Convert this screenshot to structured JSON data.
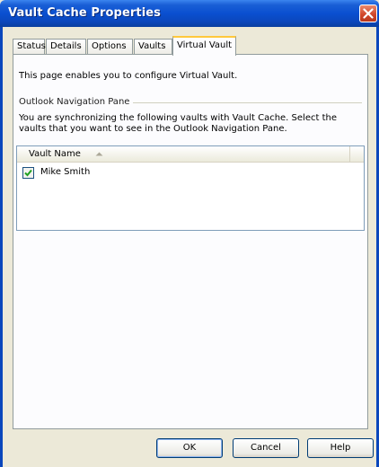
{
  "window": {
    "title": "Vault Cache Properties",
    "close_icon": "close-icon",
    "title_bar_color": "#0a4fd0"
  },
  "tabs": [
    {
      "label": "Status",
      "active": false
    },
    {
      "label": "Details",
      "active": false
    },
    {
      "label": "Options",
      "active": false
    },
    {
      "label": "Vaults",
      "active": false
    },
    {
      "label": "Virtual Vault",
      "active": true
    }
  ],
  "page": {
    "description": "This page enables you to configure Virtual Vault.",
    "group_label": "Outlook Navigation Pane",
    "sync_text": "You are synchronizing the following vaults with Vault Cache. Select the vaults that you want to see in the Outlook Navigation Pane."
  },
  "vault_list": {
    "column_header": "Vault Name",
    "sort_icon": "sort-ascending-icon",
    "rows": [
      {
        "name": "Mike Smith",
        "checked": true
      }
    ]
  },
  "buttons": {
    "ok": "OK",
    "cancel": "Cancel",
    "help": "Help"
  }
}
